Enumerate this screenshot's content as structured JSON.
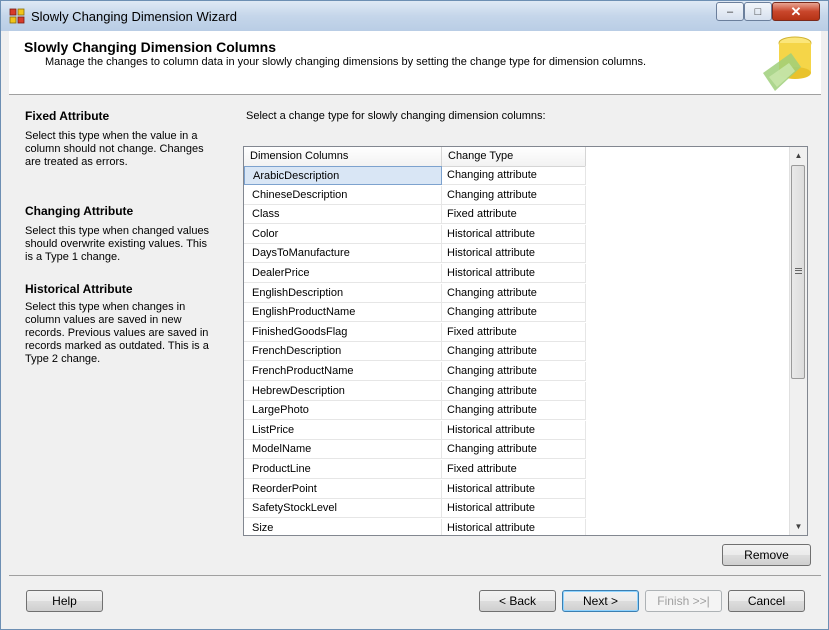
{
  "window": {
    "title": "Slowly Changing Dimension Wizard",
    "controls": {
      "minimize": "–",
      "maximize": "□",
      "close": "✕"
    }
  },
  "header": {
    "title": "Slowly Changing Dimension Columns",
    "subtitle": "Manage the changes to column data in your slowly changing dimensions by setting the change type for dimension columns."
  },
  "left_panel": {
    "sections": [
      {
        "heading": "Fixed Attribute",
        "text": "Select this type when the value in a column should not change. Changes are treated as errors."
      },
      {
        "heading": "Changing Attribute",
        "text": "Select this type when changed values should overwrite existing values. This is a Type 1 change."
      },
      {
        "heading": "Historical Attribute",
        "text": "Select this type when changes in column values are saved in new records. Previous values are saved in records marked as outdated. This is a Type 2 change."
      }
    ]
  },
  "main": {
    "instruction": "Select a change type for slowly changing dimension columns:",
    "grid": {
      "columns": [
        "Dimension Columns",
        "Change Type"
      ],
      "selected_row": 0,
      "rows": [
        {
          "name": "ArabicDescription",
          "type": "Changing attribute"
        },
        {
          "name": "ChineseDescription",
          "type": "Changing attribute"
        },
        {
          "name": "Class",
          "type": "Fixed attribute"
        },
        {
          "name": "Color",
          "type": "Historical attribute"
        },
        {
          "name": "DaysToManufacture",
          "type": "Historical attribute"
        },
        {
          "name": "DealerPrice",
          "type": "Historical attribute"
        },
        {
          "name": "EnglishDescription",
          "type": "Changing attribute"
        },
        {
          "name": "EnglishProductName",
          "type": "Changing attribute"
        },
        {
          "name": "FinishedGoodsFlag",
          "type": "Fixed attribute"
        },
        {
          "name": "FrenchDescription",
          "type": "Changing attribute"
        },
        {
          "name": "FrenchProductName",
          "type": "Changing attribute"
        },
        {
          "name": "HebrewDescription",
          "type": "Changing attribute"
        },
        {
          "name": "LargePhoto",
          "type": "Changing attribute"
        },
        {
          "name": "ListPrice",
          "type": "Historical attribute"
        },
        {
          "name": "ModelName",
          "type": "Changing attribute"
        },
        {
          "name": "ProductLine",
          "type": "Fixed attribute"
        },
        {
          "name": "ReorderPoint",
          "type": "Historical attribute"
        },
        {
          "name": "SafetyStockLevel",
          "type": "Historical attribute"
        },
        {
          "name": "Size",
          "type": "Historical attribute"
        }
      ]
    },
    "remove_label": "Remove"
  },
  "footer": {
    "help": "Help",
    "back": "< Back",
    "next": "Next >",
    "finish": "Finish >>|",
    "cancel": "Cancel"
  }
}
